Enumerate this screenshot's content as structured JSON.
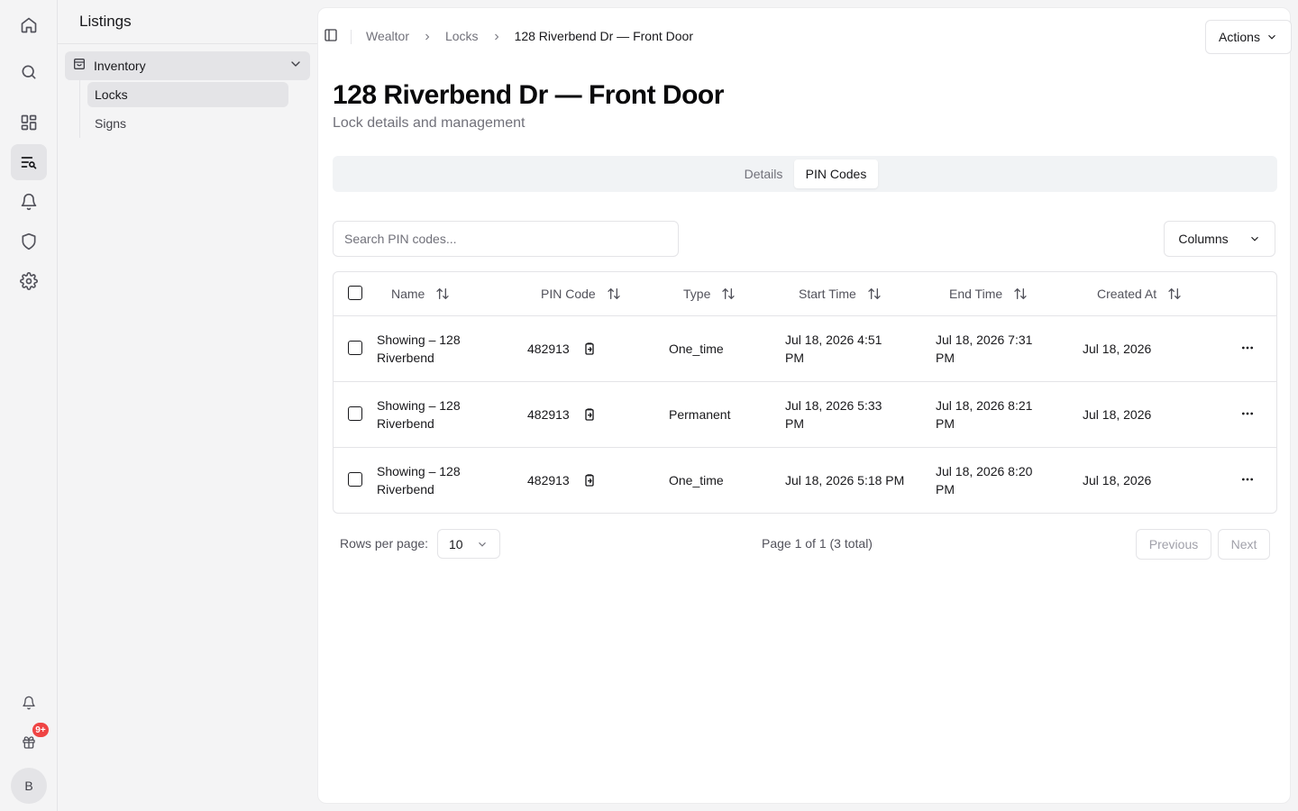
{
  "sidebar": {
    "title": "Listings",
    "group_label": "Inventory",
    "items": [
      {
        "label": "Locks",
        "active": true
      },
      {
        "label": "Signs",
        "active": false
      }
    ]
  },
  "rail": {
    "icons": [
      "home-icon",
      "search-icon",
      "dashboard-icon",
      "listings-icon",
      "bell-icon",
      "shield-icon",
      "gear-icon"
    ],
    "bottom_icons": [
      "notification-bell-icon",
      "gift-icon"
    ],
    "badge": "9+",
    "avatar": "B"
  },
  "breadcrumb": {
    "items": [
      "Wealtor",
      "Locks"
    ],
    "current": "128 Riverbend Dr — Front Door"
  },
  "header": {
    "actions_label": "Actions"
  },
  "page": {
    "title": "128 Riverbend Dr — Front Door",
    "subtitle": "Lock details and management"
  },
  "tabs": [
    {
      "label": "Details",
      "active": false
    },
    {
      "label": "PIN Codes",
      "active": true
    }
  ],
  "toolbar": {
    "search_placeholder": "Search PIN codes...",
    "columns_label": "Columns"
  },
  "table": {
    "columns": [
      "Name",
      "PIN Code",
      "Type",
      "Start Time",
      "End Time",
      "Created At"
    ],
    "rows": [
      {
        "name": "Showing – 128 Riverbend",
        "pin": "482913",
        "type": "One_time",
        "start": "Jul 18, 2026 4:51 PM",
        "end": "Jul 18, 2026 7:31 PM",
        "created": "Jul 18, 2026"
      },
      {
        "name": "Showing – 128 Riverbend",
        "pin": "482913",
        "type": "Permanent",
        "start": "Jul 18, 2026 5:33 PM",
        "end": "Jul 18, 2026 8:21 PM",
        "created": "Jul 18, 2026"
      },
      {
        "name": "Showing – 128 Riverbend",
        "pin": "482913",
        "type": "One_time",
        "start": "Jul 18, 2026 5:18 PM",
        "end": "Jul 18, 2026 8:20 PM",
        "created": "Jul 18, 2026"
      }
    ]
  },
  "pagination": {
    "rows_label": "Rows per page:",
    "rows_value": "10",
    "page_info": "Page 1 of 1 (3 total)",
    "previous_label": "Previous",
    "next_label": "Next"
  },
  "colors": {
    "accent": "#18181b",
    "badge": "#ef4444",
    "muted": "#71717a"
  }
}
